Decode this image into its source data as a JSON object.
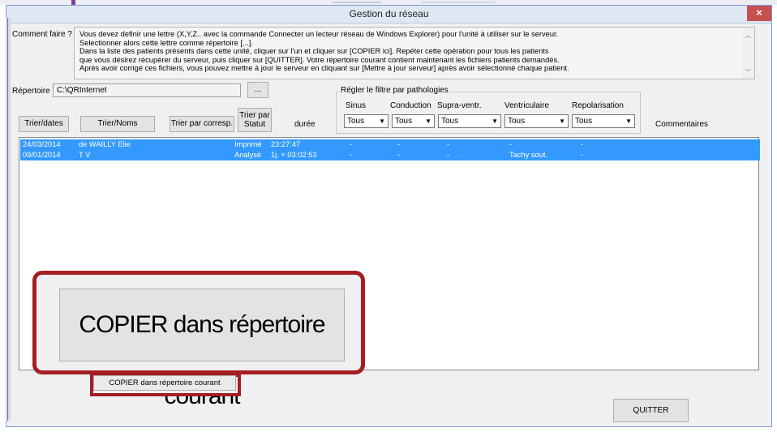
{
  "window": {
    "title": "Gestion du réseau",
    "close_glyph": "×"
  },
  "help": {
    "label": "Comment faire ?",
    "lines": [
      "Vous devez definir une lettre (X,Y,Z.. avec la commande Connecter un lecteur réseau de Windows Explorer) pour l'unité à utiliser sur le serveur.",
      "Selectionner alors cette lettre comme répertoire [...].",
      "Dans la liste des patients présents dans cette unité, cliquer sur l'un et cliquer sur [COPIER ici]. Repéter cette opération pour tous les patients",
      "que vous désirez récupérer du serveur, puis cliquer sur [QUITTER]. Votre répertoire courant contient maintenant les fichiers patients demandés.",
      "Après avoir corrigé ces fichiers, vous pouvez mettre à jour le serveur en cliquant sur [Mettre à jour serveur] après avoir sélectionné chaque patient."
    ]
  },
  "directory": {
    "label": "Répertoire",
    "value": "C:\\QRInternet",
    "browse_label": "..."
  },
  "filter": {
    "title": "Régler le filtre par pathologies",
    "columns": [
      {
        "label": "Sinus",
        "value": "Tous"
      },
      {
        "label": "Conduction",
        "value": "Tous"
      },
      {
        "label": "Supra-ventr.",
        "value": "Tous"
      },
      {
        "label": "Ventriculaire",
        "value": "Tous"
      },
      {
        "label": "Repolarisation",
        "value": "Tous"
      }
    ]
  },
  "sort": {
    "by_date": "Trier/dates",
    "by_name": "Trier/Noms",
    "by_corresp": "Trier par corresp.",
    "by_status_line1": "Trier par",
    "by_status_line2": "Statut"
  },
  "columns": {
    "duree": "durée",
    "comments": "Commentaires"
  },
  "rows": [
    {
      "date": "24/03/2014",
      "name": "de WAILLY Elie",
      "status": "Imprimé",
      "duree": "23:27:47",
      "sinus": "-",
      "conduction": "-",
      "supra": "-",
      "ventricular": "-",
      "repol": "-"
    },
    {
      "date": "09/01/2014",
      "name": "T V",
      "status": "Analysé",
      "duree": "1j. + 03:02:53",
      "sinus": "-",
      "conduction": "-",
      "supra": "-",
      "ventricular": "Tachy sout.",
      "repol": "-"
    }
  ],
  "actions": {
    "copy_zoom_label": "COPIER dans répertoire courant",
    "copy_label": "COPIER dans répertoire courant",
    "quit_label": "QUITTER"
  },
  "colors": {
    "selection": "#3399ff",
    "highlight_frame": "#a51e23",
    "close_button": "#c75050"
  },
  "icons": {
    "dropdown": "triangle-down",
    "scroll_up": "chevron-up",
    "scroll_down": "chevron-down"
  }
}
